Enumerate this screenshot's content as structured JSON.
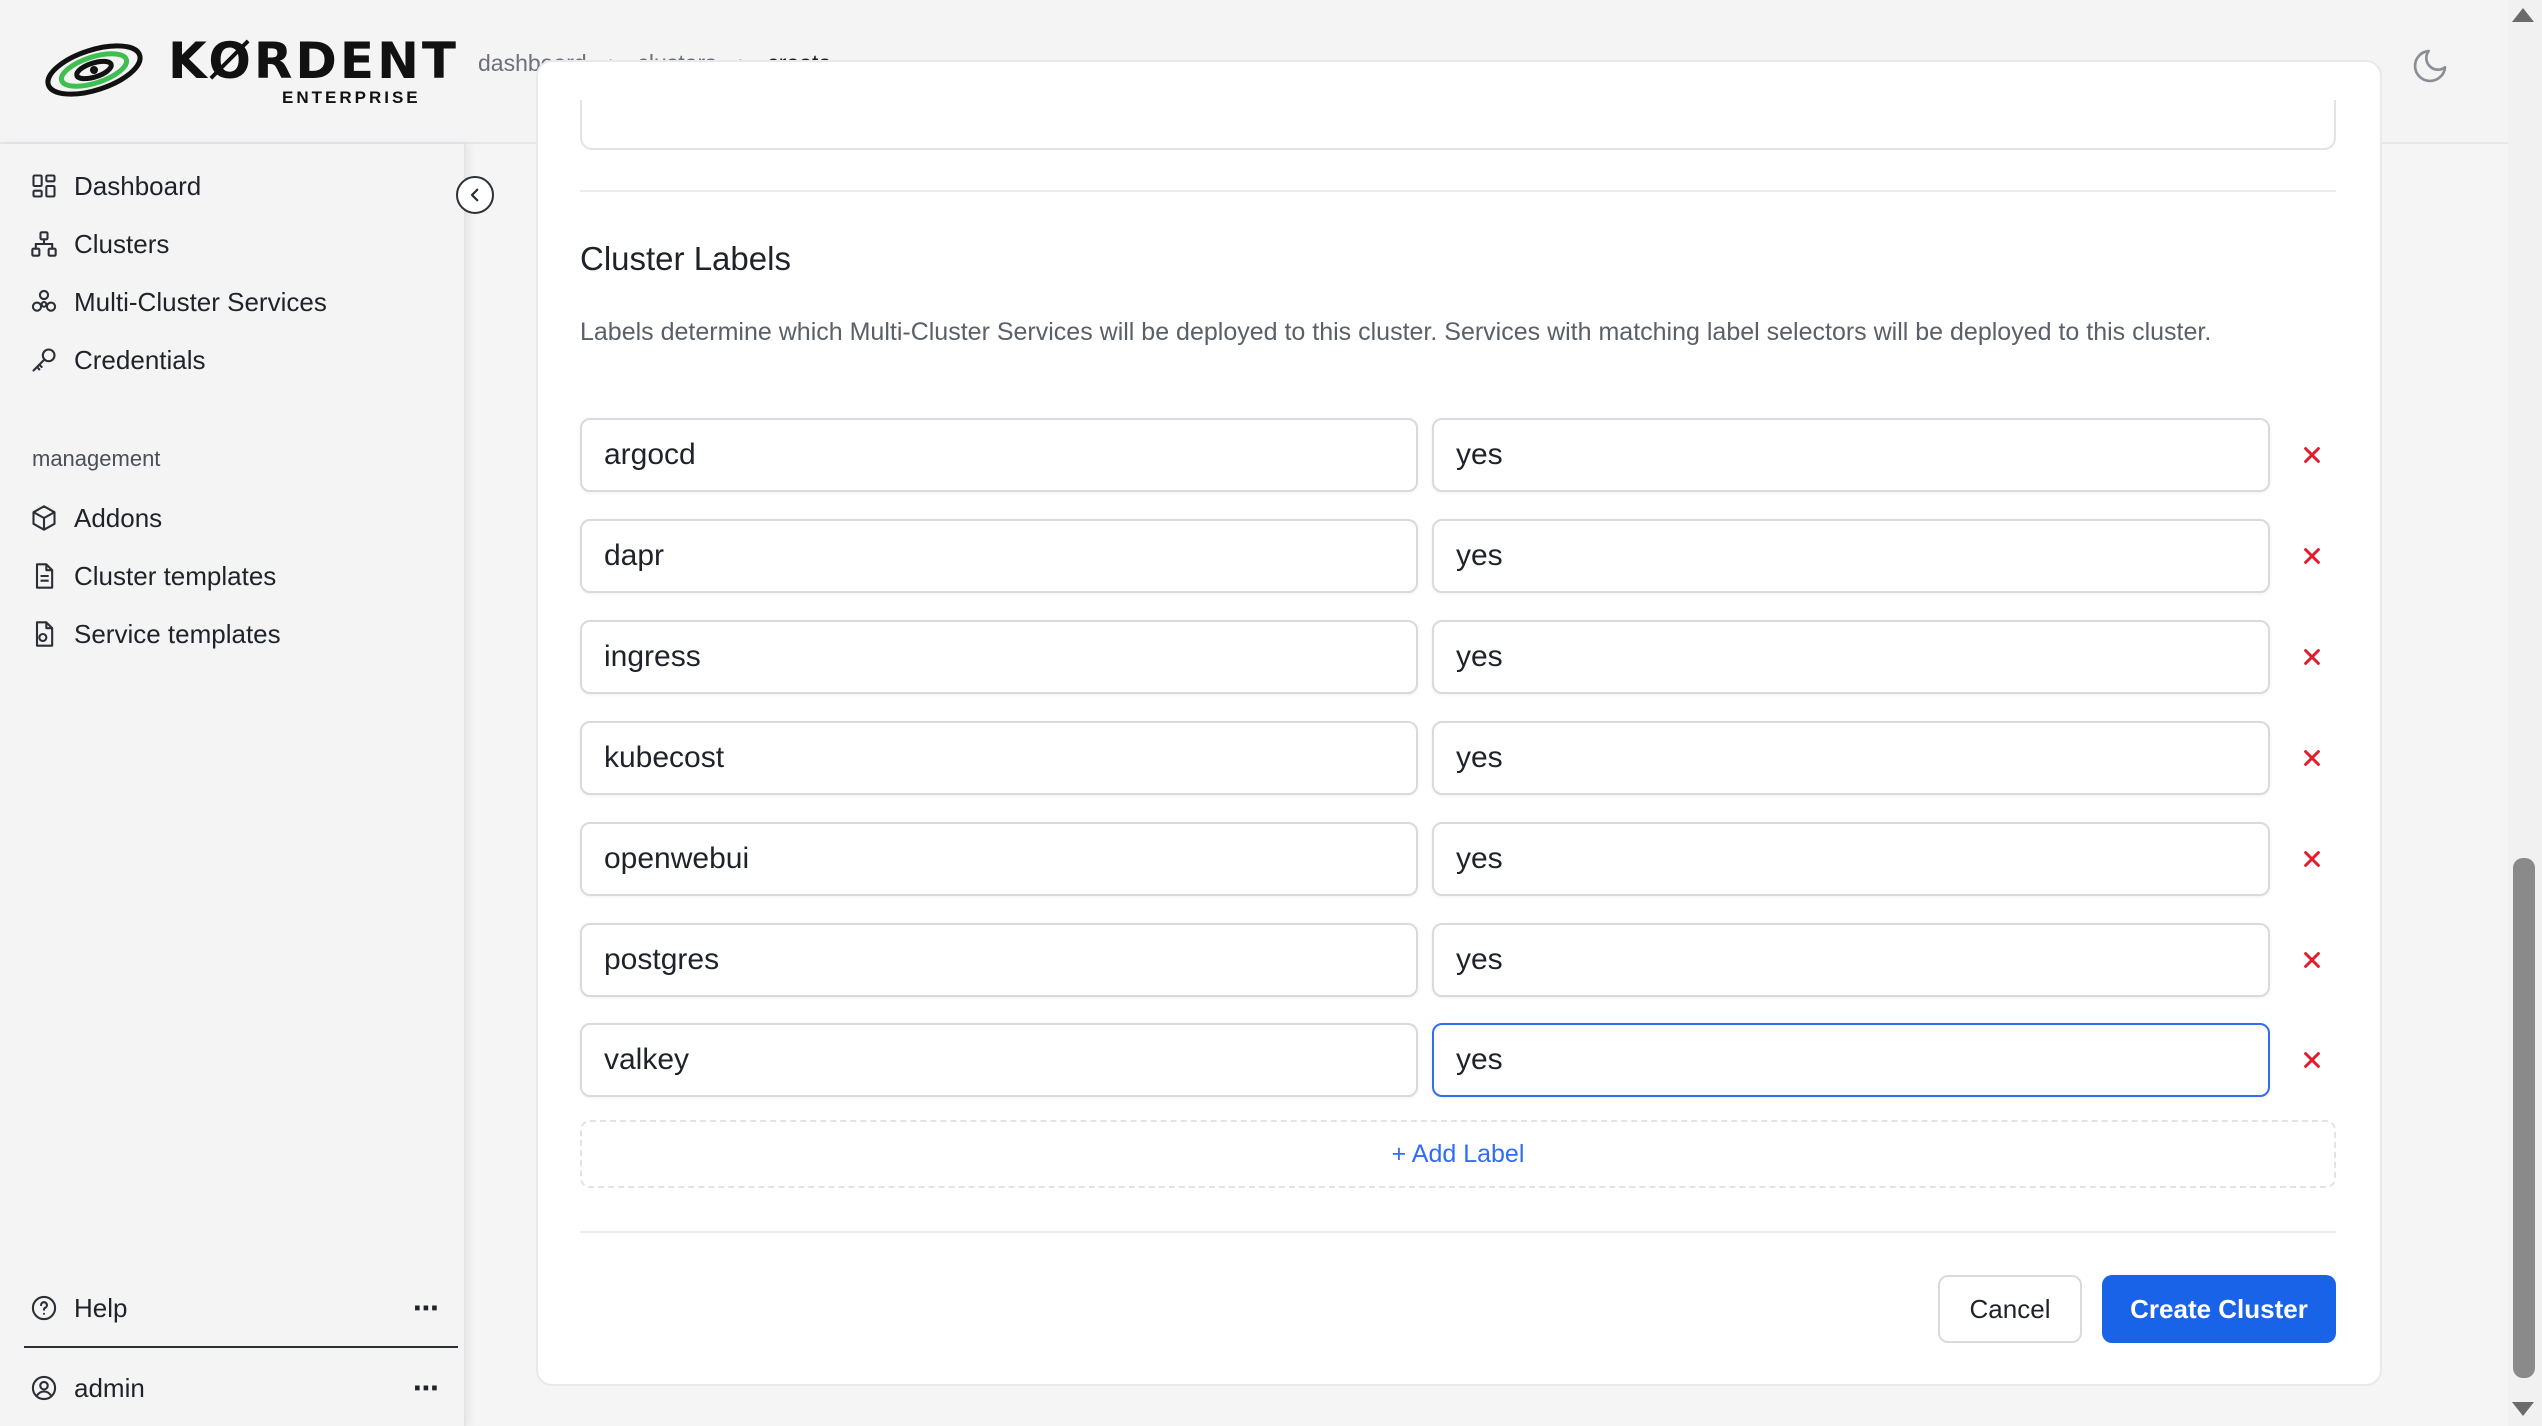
{
  "brand": {
    "name": "KØRDENT",
    "subtitle": "ENTERPRISE"
  },
  "breadcrumb": {
    "items": [
      "dashboard",
      "clusters",
      "create"
    ]
  },
  "sidebar": {
    "items": [
      {
        "label": "Dashboard",
        "icon": "dashboard-icon"
      },
      {
        "label": "Clusters",
        "icon": "clusters-icon"
      },
      {
        "label": "Multi-Cluster Services",
        "icon": "multi-cluster-icon"
      },
      {
        "label": "Credentials",
        "icon": "key-icon"
      }
    ],
    "management_label": "management",
    "management_items": [
      {
        "label": "Addons",
        "icon": "cube-icon"
      },
      {
        "label": "Cluster templates",
        "icon": "file-icon"
      },
      {
        "label": "Service templates",
        "icon": "service-file-icon"
      }
    ],
    "help_label": "Help",
    "user_label": "admin"
  },
  "labels_section": {
    "title": "Cluster Labels",
    "description": "Labels determine which Multi-Cluster Services will be deployed to this cluster. Services with matching label selectors will be deployed to this cluster.",
    "rows": [
      {
        "key": "argocd",
        "value": "yes"
      },
      {
        "key": "dapr",
        "value": "yes"
      },
      {
        "key": "ingress",
        "value": "yes"
      },
      {
        "key": "kubecost",
        "value": "yes"
      },
      {
        "key": "openwebui",
        "value": "yes"
      },
      {
        "key": "postgres",
        "value": "yes"
      },
      {
        "key": "valkey",
        "value": "yes"
      }
    ],
    "add_label": "+ Add Label"
  },
  "actions": {
    "cancel": "Cancel",
    "create": "Create Cluster"
  },
  "colors": {
    "accent": "#1963e8",
    "remove": "#e11d2e",
    "focus": "#2f6df6"
  }
}
